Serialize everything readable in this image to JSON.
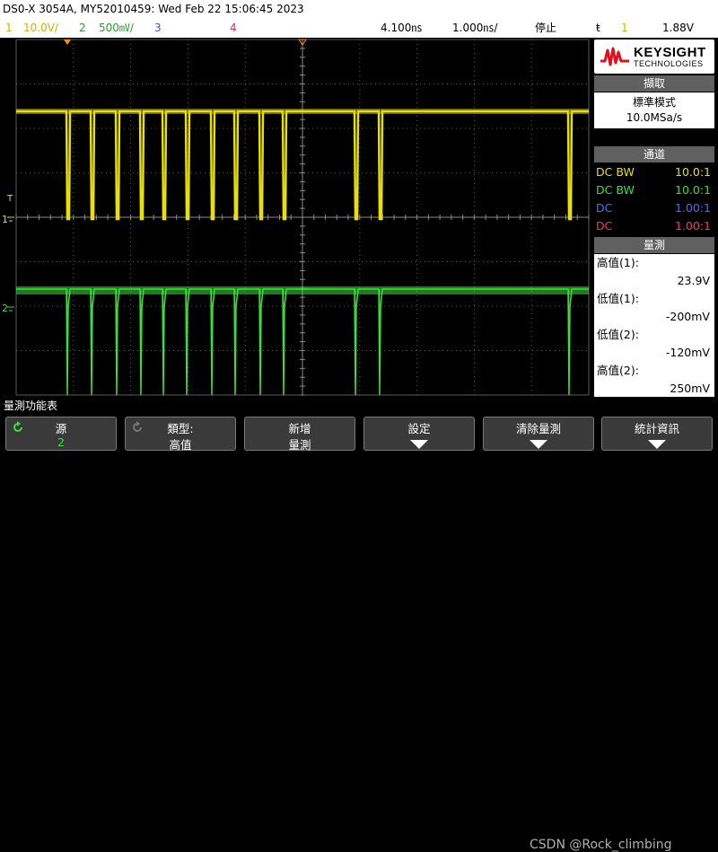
{
  "titlebar": {
    "text": "DS0-X 3054A, MY52010459: Wed Feb 22 15:06:45 2023"
  },
  "status": {
    "ch1_num": "1",
    "ch1_scale": "10.0V/",
    "ch2_num": "2",
    "ch2_scale": "500㎷/",
    "ch3_num": "3",
    "ch4_num": "4",
    "time_delay": "4.100㎱",
    "time_scale": "1.000㎱/",
    "run_state": "停止",
    "trig_icon": "ŧ",
    "trig_ch": "1",
    "trig_level": "1.88V"
  },
  "colors": {
    "ch1": "#e8e000",
    "ch2": "#3ae03a",
    "ch3": "#4d6cff",
    "ch4": "#ff2f7f",
    "grid": "#5a5a5a"
  },
  "markers": {
    "trigger_T": "T",
    "ch1_marker": "1",
    "ch2_marker": "2"
  },
  "sidebar": {
    "brand": "KEYSIGHT",
    "brand_sub": "TECHNOLOGIES",
    "acq": {
      "header": "擷取",
      "mode": "標準模式",
      "rate": "10.0MSa/s"
    },
    "channels": {
      "header": "通道",
      "rows": [
        {
          "coupling": "DC BW",
          "ratio": "10.0:1"
        },
        {
          "coupling": "DC BW",
          "ratio": "10.0:1"
        },
        {
          "coupling": "DC",
          "ratio": "1.00:1"
        },
        {
          "coupling": "DC",
          "ratio": "1.00:1"
        }
      ]
    },
    "measure": {
      "header": "量測",
      "items": [
        {
          "label": "高值(1):",
          "value": "23.9V"
        },
        {
          "label": "低值(1):",
          "value": "-200mV"
        },
        {
          "label": "低值(2):",
          "value": "-120mV"
        },
        {
          "label": "高值(2):",
          "value": "250mV"
        }
      ]
    }
  },
  "bottom_label": "量測功能表",
  "softkeys": [
    {
      "top": "源",
      "bottom": "2"
    },
    {
      "top": "類型:",
      "bottom": "高值"
    },
    {
      "top": "新增",
      "bottom": "量測"
    },
    {
      "top": "設定",
      "bottom": ""
    },
    {
      "top": "清除量測",
      "bottom": ""
    },
    {
      "top": "統計資訊",
      "bottom": ""
    }
  ],
  "watermark": "CSDN @Rock_climbing"
}
